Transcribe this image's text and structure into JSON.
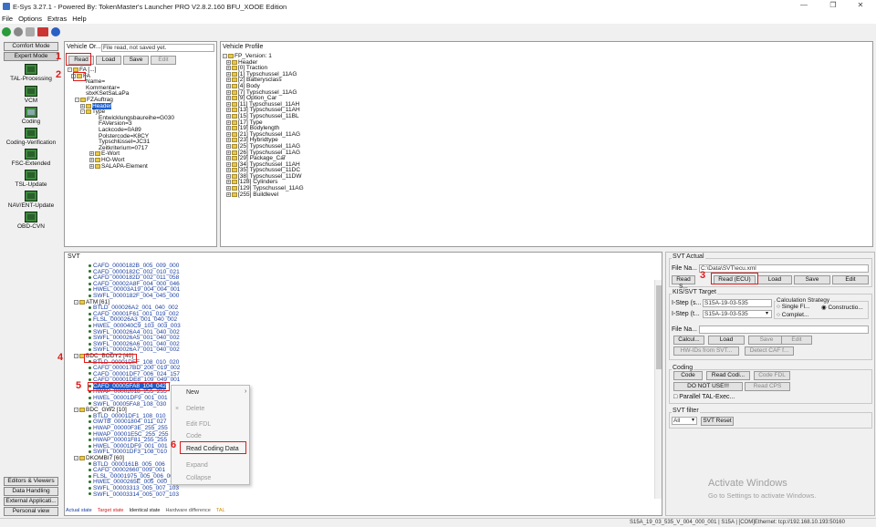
{
  "window": {
    "title": "E-Sys 3.27.1 - Powered By: TokenMaster's Launcher PRO V2.8.2.160 BFU_XOOE Edition"
  },
  "menu": [
    "File",
    "Options",
    "Extras",
    "Help"
  ],
  "toolbar_icons": [
    "connect-icon",
    "disconnect-icon",
    "settings-icon",
    "screen-icon",
    "help-icon"
  ],
  "sidebar": {
    "comfort_mode": "Comfort Mode",
    "expert_mode": "Expert Mode",
    "items": [
      "TAL-Processing",
      "VCM",
      "Coding",
      "Coding-Verification",
      "FSC-Extended",
      "TSL-Update",
      "NAV/ENT-Update",
      "OBD-CVN"
    ],
    "bottom": [
      "Editors & Viewers",
      "Data Handling",
      "External Applicati...",
      "Personal view"
    ]
  },
  "vehicle_order": {
    "label": "Vehicle Or...",
    "file_status": "File read, not saved yet.",
    "buttons": [
      "Read",
      "Load",
      "Save",
      "Edit"
    ],
    "tree": [
      "FA [...]",
      "FA",
      "Name=",
      "Kommentar=",
      "sbxKSetSaLaPa",
      "FZAuftrag",
      "Header",
      "Type",
      "Entwicklungsbaureihe=G030",
      "FAVersion=3",
      "Lackcode=0A89",
      "Polstercode=K8CY",
      "Typschlüssel=JC31",
      "Zeitkriterium=0717",
      "E-Wort",
      "HO-Wort",
      "SALAPA-Element"
    ]
  },
  "vehicle_profile": {
    "label": "Vehicle Profile",
    "items": [
      "FP_Version: 1",
      "Header",
      "[0] Traction",
      "[1] Typschussel_11AG",
      "[2] Batterysclass",
      "[4] Body",
      "[7] Typschussel_11AG",
      "[9] Option_Car",
      "[11] Typschussel_11AH",
      "[13] Typschussel_11AH",
      "[15] Typschussel_11BL",
      "[17] Type",
      "[19] Bodylength",
      "[21] Typschussel_11AG",
      "[23] Hybridtype",
      "[25] Typschussel_11AG",
      "[26] Typschussel_11AG",
      "[29] Package_Car",
      "[34] Typschussel_11AH",
      "[35] Typschussel_11DC",
      "[38] Typschussel_11DW",
      "[128] Cylinders",
      "[129] Typschussel_11AG",
      "[255] Buildlevel"
    ]
  },
  "svt": {
    "label": "SVT",
    "rows": [
      {
        "t": "s",
        "v": "CAFD_0000182B_005_009_000"
      },
      {
        "t": "s",
        "v": "CAFD_0000182C_002_010_021"
      },
      {
        "t": "s",
        "v": "CAFD_0000182D_002_011_058"
      },
      {
        "t": "s",
        "v": "CAFD_00002A8F_004_000_046"
      },
      {
        "t": "s",
        "v": "HWEL_00003A19_004_004_001"
      },
      {
        "t": "s",
        "v": "SWFL_0000182F_004_045_000"
      },
      {
        "t": "f",
        "v": "ATM [61]"
      },
      {
        "t": "s",
        "v": "BTLD_000026A2_001_040_002"
      },
      {
        "t": "s",
        "v": "CAFD_00001F61_001_019_002"
      },
      {
        "t": "s",
        "v": "FLSL_000026A3_001_040_002"
      },
      {
        "t": "s",
        "v": "HWEL_000040C9_103_003_003"
      },
      {
        "t": "s",
        "v": "SWFL_000026A4_001_040_002"
      },
      {
        "t": "s",
        "v": "SWFL_000026A5_001_040_002"
      },
      {
        "t": "s",
        "v": "SWFL_000026A6_001_040_002"
      },
      {
        "t": "s",
        "v": "SWFL_000026A7_001_040_002"
      },
      {
        "t": "f",
        "v": "BDC_BODY2 [40]"
      },
      {
        "t": "s",
        "v": "BTLD_00001DFF_108_010_020"
      },
      {
        "t": "s",
        "v": "CAFD_000017BD_200_019_002"
      },
      {
        "t": "s",
        "v": "CAFD_00001DF7_006_024_157"
      },
      {
        "t": "s",
        "v": "CAFD_00001DE8_109_049_001"
      },
      {
        "t": "s",
        "v": "CAFD_00005FA8_104_042"
      },
      {
        "t": "s",
        "v": "HWAP_00002018_255_255"
      },
      {
        "t": "s",
        "v": "HWEL_00001DF9_001_001"
      },
      {
        "t": "s",
        "v": "SWFL_00005FA8_108_030"
      },
      {
        "t": "f",
        "v": "BDC_GW2 [10]"
      },
      {
        "t": "s",
        "v": "BTLD_00001DF1_108_010"
      },
      {
        "t": "s",
        "v": "GWTB_00001804_011_027"
      },
      {
        "t": "s",
        "v": "HWAP_00000F3E_255_255"
      },
      {
        "t": "s",
        "v": "HWAP_00001E5C_255_255"
      },
      {
        "t": "s",
        "v": "HWAP_00001F81_255_255"
      },
      {
        "t": "s",
        "v": "HWEL_00001DF9_001_001"
      },
      {
        "t": "s",
        "v": "SWFL_00001DF3_108_010"
      },
      {
        "t": "f",
        "v": "DKOMBI7 [60]"
      },
      {
        "t": "s",
        "v": "BTLD_0000161B_005_006"
      },
      {
        "t": "s",
        "v": "CAFD_00002660_009_001"
      },
      {
        "t": "s",
        "v": "FLSL_00001975_005_006_002"
      },
      {
        "t": "s",
        "v": "HWEL_0000265E_005_000_000"
      },
      {
        "t": "s",
        "v": "SWFL_00003313_005_007_103"
      },
      {
        "t": "s",
        "v": "SWFL_00003314_005_007_103"
      }
    ],
    "legend": [
      "Actual state",
      "Target state",
      "Identical state",
      "Hardware difference",
      "TAL"
    ]
  },
  "context_menu": {
    "items": [
      "New",
      "Delete",
      "Edit FDL",
      "Code",
      "Read Coding Data",
      "Expand",
      "Collapse"
    ]
  },
  "svt_actual": {
    "label": "SVT Actual",
    "file_label": "File Na...",
    "file_value": "C:\\Data\\SVT\\ecu.xml",
    "buttons": [
      "Read S...",
      "Read (ECU)",
      "Load",
      "Save",
      "Edit"
    ]
  },
  "kis": {
    "label": "KIS/SVT Target",
    "istep_s_label": "I-Step (s...",
    "istep_s_value": "S15A-19-03-535",
    "istep_t_label": "I-Step (t...",
    "istep_t_value": "S15A-19-03-535",
    "calc_label": "Calculation Strategy",
    "radios": [
      "Single Fl...",
      "Constructio...",
      "Complet..."
    ],
    "file_label": "File Na...",
    "buttons": [
      "Calcul...",
      "Load",
      "Save",
      "Edit"
    ],
    "hw_ids": "HW-IDs from SVT...",
    "detect_caf": "Detect CAF f..."
  },
  "coding": {
    "label": "Coding",
    "buttons": [
      "Code",
      "Read Codi...",
      "Code FDL"
    ],
    "do_not_use": "DO NOT USE!!!",
    "read_cps": "Read CPS",
    "parallel": "Parallel TAL-Exec..."
  },
  "svt_filter": {
    "label": "SVT filter",
    "value": "All",
    "reset": "SVT Reset"
  },
  "watermark": {
    "line1": "Activate Windows",
    "line2": "Go to Settings to activate Windows."
  },
  "annotations": [
    "1",
    "2",
    "3",
    "4",
    "5",
    "6"
  ],
  "status": "S15A_19_03_535_V_004_000_001 | S15A | [COM]Ethernet: tcp://192.168.10.193:50160"
}
